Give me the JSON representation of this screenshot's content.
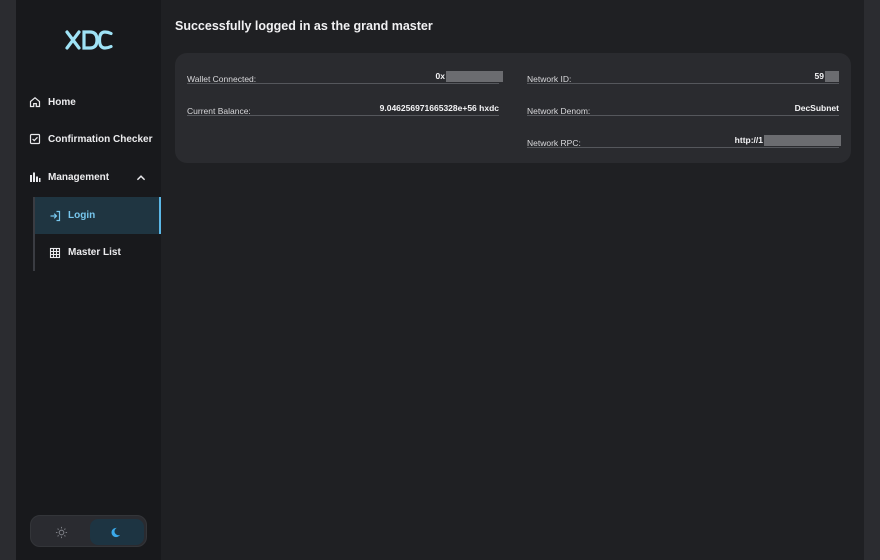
{
  "sidebar": {
    "logo_text": "XDC",
    "nav": {
      "home": "Home",
      "confirmation_checker": "Confirmation Checker",
      "management": "Management"
    },
    "management_items": {
      "login": "Login",
      "master_list": "Master List"
    }
  },
  "main": {
    "title": "Successfully logged in as the grand master",
    "card": {
      "wallet_connected_label": "Wallet Connected:",
      "wallet_connected_value": "0x",
      "current_balance_label": "Current Balance:",
      "current_balance_value": "9.046256971665328e+56 hxdc",
      "network_id_label": "Network ID:",
      "network_id_value": "59",
      "network_denom_label": "Network Denom:",
      "network_denom_value": "DecSubnet",
      "network_rpc_label": "Network RPC:",
      "network_rpc_value": "http://1"
    }
  },
  "colors": {
    "accent": "#5bb7e6",
    "sidebar_bg": "#18191c",
    "main_bg": "#1f2023",
    "card_bg": "#2a2b2f"
  },
  "icons": [
    "home-icon",
    "checklist-icon",
    "bar-chart-icon",
    "chevron-up-icon",
    "login-icon",
    "table-icon",
    "sun-icon",
    "moon-icon"
  ]
}
